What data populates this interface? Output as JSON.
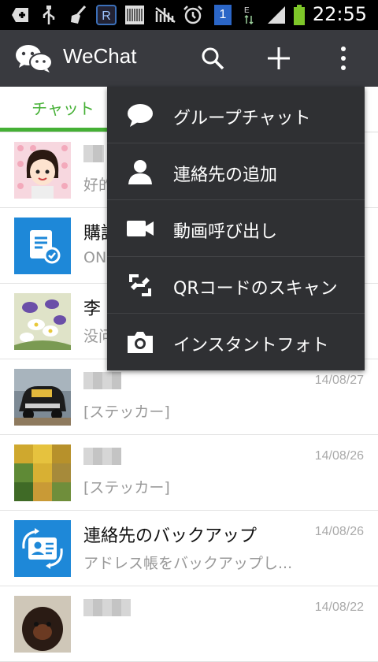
{
  "status_bar": {
    "time": "22:55",
    "icons": [
      "add-icon",
      "usb-icon",
      "broom-icon",
      "r-app-icon",
      "barcode-icon",
      "signal-off-icon",
      "alarm-icon",
      "notification-1-icon",
      "data-transfer-icon",
      "signal-icon",
      "battery-icon"
    ],
    "badge_number": "1"
  },
  "app_bar": {
    "title": "WeChat",
    "actions": [
      "search-icon",
      "plus-icon",
      "overflow-icon"
    ]
  },
  "tabs": [
    {
      "label": "チャット",
      "active": true
    }
  ],
  "chats": [
    {
      "name": "",
      "message": "好的",
      "date": ""
    },
    {
      "name": "購読",
      "message": "ON",
      "date": ""
    },
    {
      "name": "李",
      "message": "没问",
      "date": ""
    },
    {
      "name": "",
      "message": "[ステッカー]",
      "date": "14/08/27"
    },
    {
      "name": "",
      "message": "[ステッカー]",
      "date": "14/08/26"
    },
    {
      "name": "連絡先のバックアップ",
      "message": "アドレス帳をバックアップし...",
      "date": "14/08/26"
    },
    {
      "name": "",
      "message": "",
      "date": "14/08/22"
    }
  ],
  "menu": {
    "items": [
      {
        "label": "グループチャット",
        "icon": "chat-bubble-icon"
      },
      {
        "label": "連絡先の追加",
        "icon": "person-icon"
      },
      {
        "label": "動画呼び出し",
        "icon": "video-camera-icon"
      },
      {
        "label": "QRコードのスキャン",
        "icon": "qr-scan-icon"
      },
      {
        "label": "インスタントフォト",
        "icon": "camera-icon"
      }
    ]
  },
  "colors": {
    "accent": "#45b035",
    "appbar": "#393a3f",
    "menu": "#2f3033"
  }
}
